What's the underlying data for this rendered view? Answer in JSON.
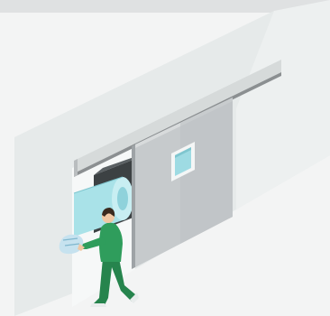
{
  "illustration": {
    "subject": "automatic-sliding-door-with-nurse",
    "colors": {
      "background": "#f3f4f4",
      "top_strip": "#dfe1e2",
      "wall_front": "#e4e8e8",
      "wall_side": "#edf0f0",
      "door_panel": "#c6cacc",
      "door_panel_edge": "#9ea3a6",
      "track": "#d6dada",
      "track_shadow": "#8b8f91",
      "window_frame": "#f4f6f6",
      "glass": "#9edbe3",
      "machine": "#3c4143",
      "cylinder": "#a9e2e8",
      "scrubs": "#2f9d5c",
      "skin": "#f0c7a3",
      "hair": "#3a2a1e",
      "iv_bag": "#c6e2ef"
    }
  }
}
